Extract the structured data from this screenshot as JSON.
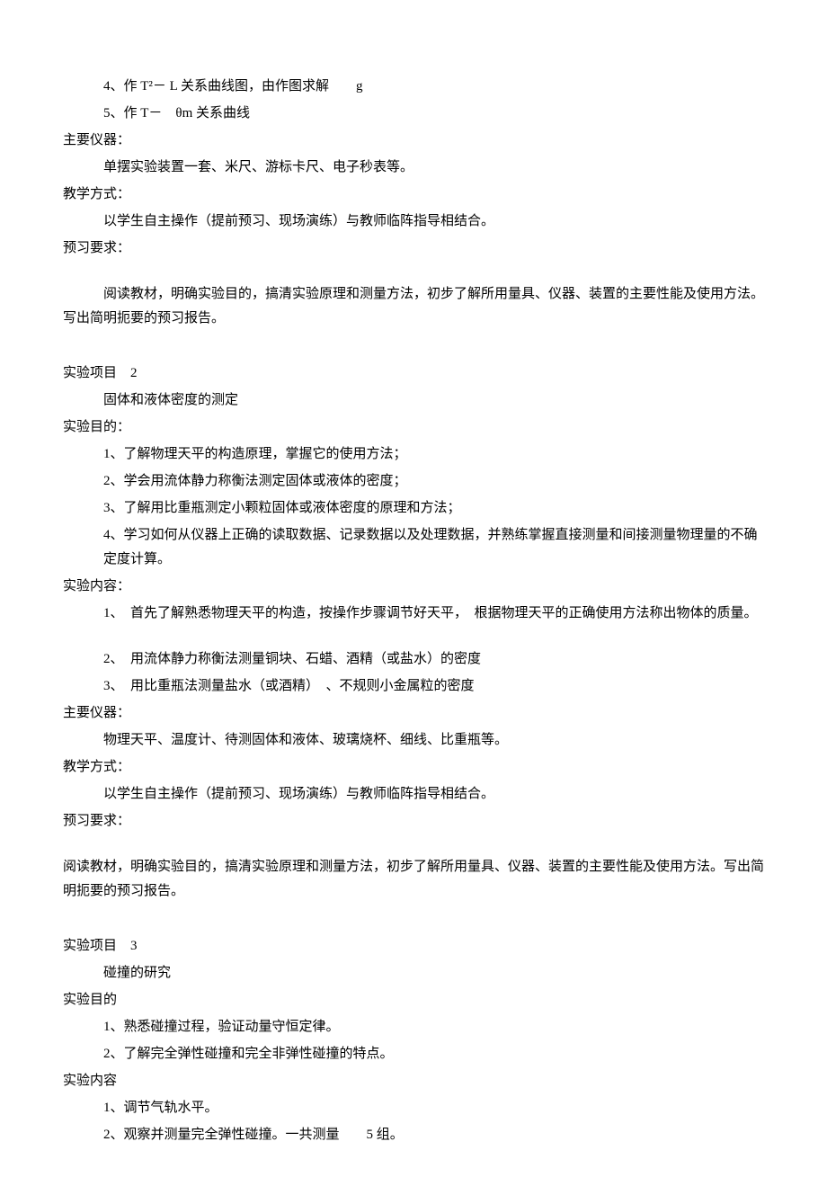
{
  "exp1_tail": {
    "content_items": [
      "4、作 T²－ L 关系曲线图，由作图求解　　g",
      "5、作 T－　θm 关系曲线"
    ],
    "instrument_label": "主要仪器：",
    "instrument_text": "单摆实验装置一套、米尺、游标卡尺、电子秒表等。",
    "teaching_label": "教学方式：",
    "teaching_text": "以学生自主操作（提前预习、现场演练）与教师临阵指导相结合。",
    "preview_label": "预习要求：",
    "preview_text": "阅读教材，明确实验目的，搞清实验原理和测量方法，初步了解所用量具、仪器、装置的主要性能及使用方法。写出简明扼要的预习报告。"
  },
  "exp2": {
    "proj_label": "实验项目　2",
    "title": "固体和液体密度的测定",
    "purpose_label": "实验目的：",
    "purpose_items": [
      "1、了解物理天平的构造原理，掌握它的使用方法；",
      "2、学会用流体静力称衡法测定固体或液体的密度；",
      "3、了解用比重瓶测定小颗粒固体或液体密度的原理和方法；",
      "4、学习如何从仪器上正确的读取数据、记录数据以及处理数据，并熟练掌握直接测量和间接测量物理量的不确定度计算。"
    ],
    "content_label": "实验内容：",
    "content_items": [
      "1、　首先了解熟悉物理天平的构造，按操作步骤调节好天平，　根据物理天平的正确使用方法称出物体的质量。",
      "2、　用流体静力称衡法测量铜块、石蜡、酒精（或盐水）的密度",
      "3、　用比重瓶法测量盐水（或酒精）　、不规则小金属粒的密度"
    ],
    "instrument_label": "主要仪器：",
    "instrument_text": "物理天平、温度计、待测固体和液体、玻璃烧杯、细线、比重瓶等。",
    "teaching_label": "教学方式：",
    "teaching_text": "以学生自主操作（提前预习、现场演练）与教师临阵指导相结合。",
    "preview_label": "预习要求：",
    "preview_text": "阅读教材，明确实验目的，搞清实验原理和测量方法，初步了解所用量具、仪器、装置的主要性能及使用方法。写出简明扼要的预习报告。"
  },
  "exp3": {
    "proj_label": "实验项目　3",
    "title": "碰撞的研究",
    "purpose_label": "实验目的",
    "purpose_items": [
      "1、熟悉碰撞过程，验证动量守恒定律。",
      "2、了解完全弹性碰撞和完全非弹性碰撞的特点。"
    ],
    "content_label": "实验内容",
    "content_items": [
      "1、调节气轨水平。",
      "2、观察并测量完全弹性碰撞。一共测量　　5 组。"
    ]
  }
}
